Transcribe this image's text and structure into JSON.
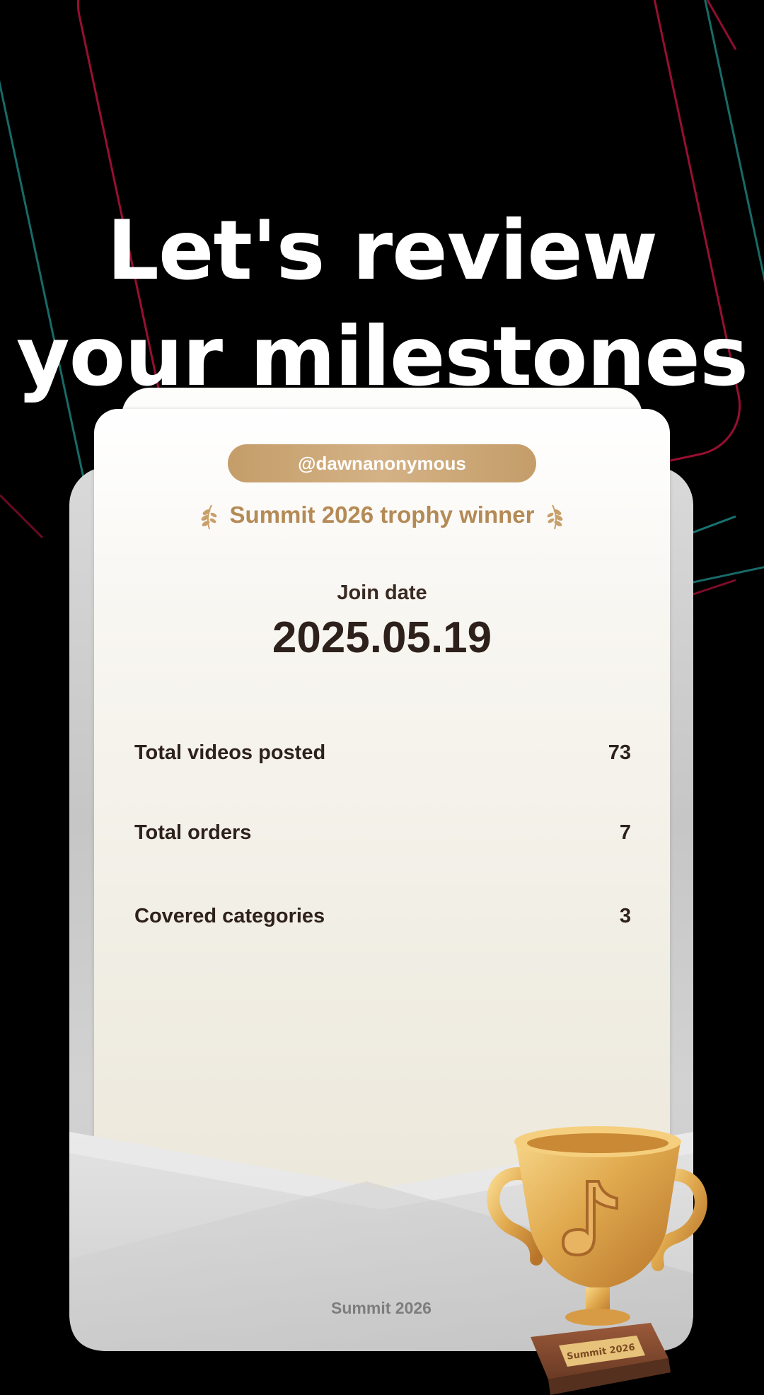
{
  "headline": {
    "line1": "Let's review",
    "line2": "your milestones"
  },
  "card": {
    "handle": "@dawnanonymous",
    "award": "Summit 2026 trophy winner",
    "join_label": "Join date",
    "join_date": "2025.05.19",
    "stats": [
      {
        "label": "Total videos posted",
        "value": "73"
      },
      {
        "label": "Total orders",
        "value": "7"
      },
      {
        "label": "Covered categories",
        "value": "3"
      }
    ],
    "footer_brand": "Summit 2026"
  },
  "trophy": {
    "plaque": "Summit 2026",
    "icon": "music-note-icon"
  },
  "colors": {
    "background": "#000000",
    "accent_gold": "#c49d69",
    "award_text": "#b48a55",
    "deco_red": "#e0143c",
    "deco_teal": "#2ad4d0"
  },
  "icons": [
    "laurel-left-icon",
    "laurel-right-icon",
    "music-note-icon"
  ]
}
